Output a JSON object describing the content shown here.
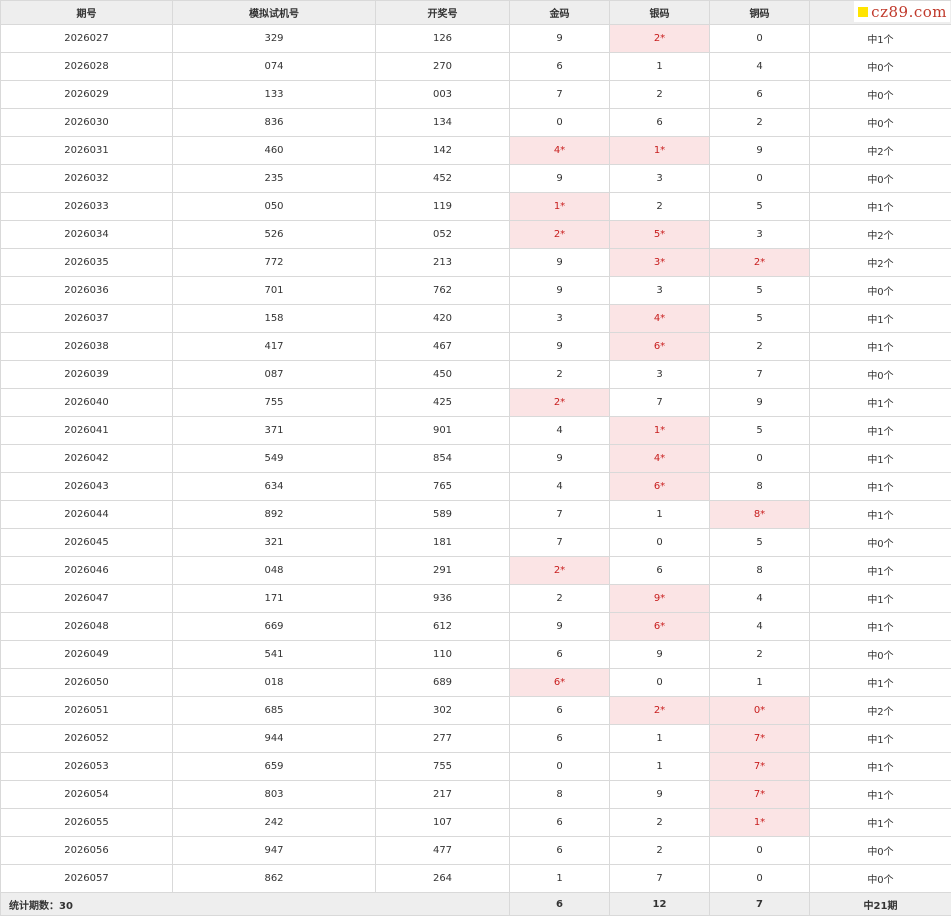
{
  "header": {
    "columns": [
      "期号",
      "模拟试机号",
      "开奖号",
      "金码",
      "银码",
      "铜码",
      ""
    ]
  },
  "watermark": {
    "text": "cz89.com",
    "color": "#c0392b",
    "square_color": "#ffe400"
  },
  "colors": {
    "hit_bg": "#fbe4e5",
    "hit_text": "#c81e1e",
    "header_bg": "#eeeeee"
  },
  "rows": [
    {
      "issue": "2026027",
      "trial": "329",
      "draw": "126",
      "gold": "9",
      "gold_hit": false,
      "silver": "2*",
      "silver_hit": true,
      "bronze": "0",
      "bronze_hit": false,
      "result": "中1个"
    },
    {
      "issue": "2026028",
      "trial": "074",
      "draw": "270",
      "gold": "6",
      "gold_hit": false,
      "silver": "1",
      "silver_hit": false,
      "bronze": "4",
      "bronze_hit": false,
      "result": "中0个"
    },
    {
      "issue": "2026029",
      "trial": "133",
      "draw": "003",
      "gold": "7",
      "gold_hit": false,
      "silver": "2",
      "silver_hit": false,
      "bronze": "6",
      "bronze_hit": false,
      "result": "中0个"
    },
    {
      "issue": "2026030",
      "trial": "836",
      "draw": "134",
      "gold": "0",
      "gold_hit": false,
      "silver": "6",
      "silver_hit": false,
      "bronze": "2",
      "bronze_hit": false,
      "result": "中0个"
    },
    {
      "issue": "2026031",
      "trial": "460",
      "draw": "142",
      "gold": "4*",
      "gold_hit": true,
      "silver": "1*",
      "silver_hit": true,
      "bronze": "9",
      "bronze_hit": false,
      "result": "中2个"
    },
    {
      "issue": "2026032",
      "trial": "235",
      "draw": "452",
      "gold": "9",
      "gold_hit": false,
      "silver": "3",
      "silver_hit": false,
      "bronze": "0",
      "bronze_hit": false,
      "result": "中0个"
    },
    {
      "issue": "2026033",
      "trial": "050",
      "draw": "119",
      "gold": "1*",
      "gold_hit": true,
      "silver": "2",
      "silver_hit": false,
      "bronze": "5",
      "bronze_hit": false,
      "result": "中1个"
    },
    {
      "issue": "2026034",
      "trial": "526",
      "draw": "052",
      "gold": "2*",
      "gold_hit": true,
      "silver": "5*",
      "silver_hit": true,
      "bronze": "3",
      "bronze_hit": false,
      "result": "中2个"
    },
    {
      "issue": "2026035",
      "trial": "772",
      "draw": "213",
      "gold": "9",
      "gold_hit": false,
      "silver": "3*",
      "silver_hit": true,
      "bronze": "2*",
      "bronze_hit": true,
      "result": "中2个"
    },
    {
      "issue": "2026036",
      "trial": "701",
      "draw": "762",
      "gold": "9",
      "gold_hit": false,
      "silver": "3",
      "silver_hit": false,
      "bronze": "5",
      "bronze_hit": false,
      "result": "中0个"
    },
    {
      "issue": "2026037",
      "trial": "158",
      "draw": "420",
      "gold": "3",
      "gold_hit": false,
      "silver": "4*",
      "silver_hit": true,
      "bronze": "5",
      "bronze_hit": false,
      "result": "中1个"
    },
    {
      "issue": "2026038",
      "trial": "417",
      "draw": "467",
      "gold": "9",
      "gold_hit": false,
      "silver": "6*",
      "silver_hit": true,
      "bronze": "2",
      "bronze_hit": false,
      "result": "中1个"
    },
    {
      "issue": "2026039",
      "trial": "087",
      "draw": "450",
      "gold": "2",
      "gold_hit": false,
      "silver": "3",
      "silver_hit": false,
      "bronze": "7",
      "bronze_hit": false,
      "result": "中0个"
    },
    {
      "issue": "2026040",
      "trial": "755",
      "draw": "425",
      "gold": "2*",
      "gold_hit": true,
      "silver": "7",
      "silver_hit": false,
      "bronze": "9",
      "bronze_hit": false,
      "result": "中1个"
    },
    {
      "issue": "2026041",
      "trial": "371",
      "draw": "901",
      "gold": "4",
      "gold_hit": false,
      "silver": "1*",
      "silver_hit": true,
      "bronze": "5",
      "bronze_hit": false,
      "result": "中1个"
    },
    {
      "issue": "2026042",
      "trial": "549",
      "draw": "854",
      "gold": "9",
      "gold_hit": false,
      "silver": "4*",
      "silver_hit": true,
      "bronze": "0",
      "bronze_hit": false,
      "result": "中1个"
    },
    {
      "issue": "2026043",
      "trial": "634",
      "draw": "765",
      "gold": "4",
      "gold_hit": false,
      "silver": "6*",
      "silver_hit": true,
      "bronze": "8",
      "bronze_hit": false,
      "result": "中1个"
    },
    {
      "issue": "2026044",
      "trial": "892",
      "draw": "589",
      "gold": "7",
      "gold_hit": false,
      "silver": "1",
      "silver_hit": false,
      "bronze": "8*",
      "bronze_hit": true,
      "result": "中1个"
    },
    {
      "issue": "2026045",
      "trial": "321",
      "draw": "181",
      "gold": "7",
      "gold_hit": false,
      "silver": "0",
      "silver_hit": false,
      "bronze": "5",
      "bronze_hit": false,
      "result": "中0个"
    },
    {
      "issue": "2026046",
      "trial": "048",
      "draw": "291",
      "gold": "2*",
      "gold_hit": true,
      "silver": "6",
      "silver_hit": false,
      "bronze": "8",
      "bronze_hit": false,
      "result": "中1个"
    },
    {
      "issue": "2026047",
      "trial": "171",
      "draw": "936",
      "gold": "2",
      "gold_hit": false,
      "silver": "9*",
      "silver_hit": true,
      "bronze": "4",
      "bronze_hit": false,
      "result": "中1个"
    },
    {
      "issue": "2026048",
      "trial": "669",
      "draw": "612",
      "gold": "9",
      "gold_hit": false,
      "silver": "6*",
      "silver_hit": true,
      "bronze": "4",
      "bronze_hit": false,
      "result": "中1个"
    },
    {
      "issue": "2026049",
      "trial": "541",
      "draw": "110",
      "gold": "6",
      "gold_hit": false,
      "silver": "9",
      "silver_hit": false,
      "bronze": "2",
      "bronze_hit": false,
      "result": "中0个"
    },
    {
      "issue": "2026050",
      "trial": "018",
      "draw": "689",
      "gold": "6*",
      "gold_hit": true,
      "silver": "0",
      "silver_hit": false,
      "bronze": "1",
      "bronze_hit": false,
      "result": "中1个"
    },
    {
      "issue": "2026051",
      "trial": "685",
      "draw": "302",
      "gold": "6",
      "gold_hit": false,
      "silver": "2*",
      "silver_hit": true,
      "bronze": "0*",
      "bronze_hit": true,
      "result": "中2个"
    },
    {
      "issue": "2026052",
      "trial": "944",
      "draw": "277",
      "gold": "6",
      "gold_hit": false,
      "silver": "1",
      "silver_hit": false,
      "bronze": "7*",
      "bronze_hit": true,
      "result": "中1个"
    },
    {
      "issue": "2026053",
      "trial": "659",
      "draw": "755",
      "gold": "0",
      "gold_hit": false,
      "silver": "1",
      "silver_hit": false,
      "bronze": "7*",
      "bronze_hit": true,
      "result": "中1个"
    },
    {
      "issue": "2026054",
      "trial": "803",
      "draw": "217",
      "gold": "8",
      "gold_hit": false,
      "silver": "9",
      "silver_hit": false,
      "bronze": "7*",
      "bronze_hit": true,
      "result": "中1个"
    },
    {
      "issue": "2026055",
      "trial": "242",
      "draw": "107",
      "gold": "6",
      "gold_hit": false,
      "silver": "2",
      "silver_hit": false,
      "bronze": "1*",
      "bronze_hit": true,
      "result": "中1个"
    },
    {
      "issue": "2026056",
      "trial": "947",
      "draw": "477",
      "gold": "6",
      "gold_hit": false,
      "silver": "2",
      "silver_hit": false,
      "bronze": "0",
      "bronze_hit": false,
      "result": "中0个"
    },
    {
      "issue": "2026057",
      "trial": "862",
      "draw": "264",
      "gold": "1",
      "gold_hit": false,
      "silver": "7",
      "silver_hit": false,
      "bronze": "0",
      "bronze_hit": false,
      "result": "中0个"
    }
  ],
  "footer": {
    "label": "统计期数：30",
    "gold_total": "6",
    "silver_total": "12",
    "bronze_total": "7",
    "result_total": "中21期"
  }
}
